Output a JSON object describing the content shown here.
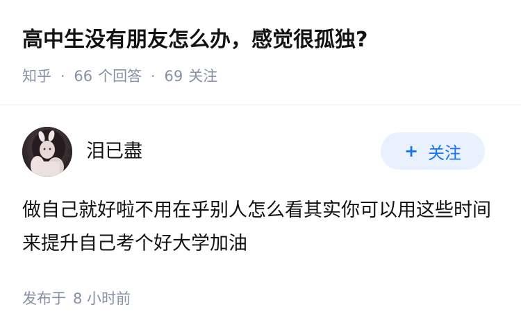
{
  "question": {
    "title": "高中生没有朋友怎么办，感觉很孤独?",
    "source": "知乎",
    "answers_count": "66",
    "answers_label": "个回答",
    "followers_count": "69",
    "followers_label": "关注"
  },
  "author": {
    "name": "泪已盡",
    "avatar_icon": "user-avatar-photo"
  },
  "follow_button": {
    "icon": "+",
    "label": "关注"
  },
  "answer": {
    "text": "做自己就好啦不用在乎别人怎么看其实你可以用这些时间来提升自己考个好大学加油"
  },
  "published": {
    "prefix": "发布于",
    "time": "8 小时前"
  },
  "colors": {
    "accent": "#1772f6",
    "accent_bg": "#e8f1fd",
    "meta_gray": "#8590a6",
    "text": "#121212"
  }
}
